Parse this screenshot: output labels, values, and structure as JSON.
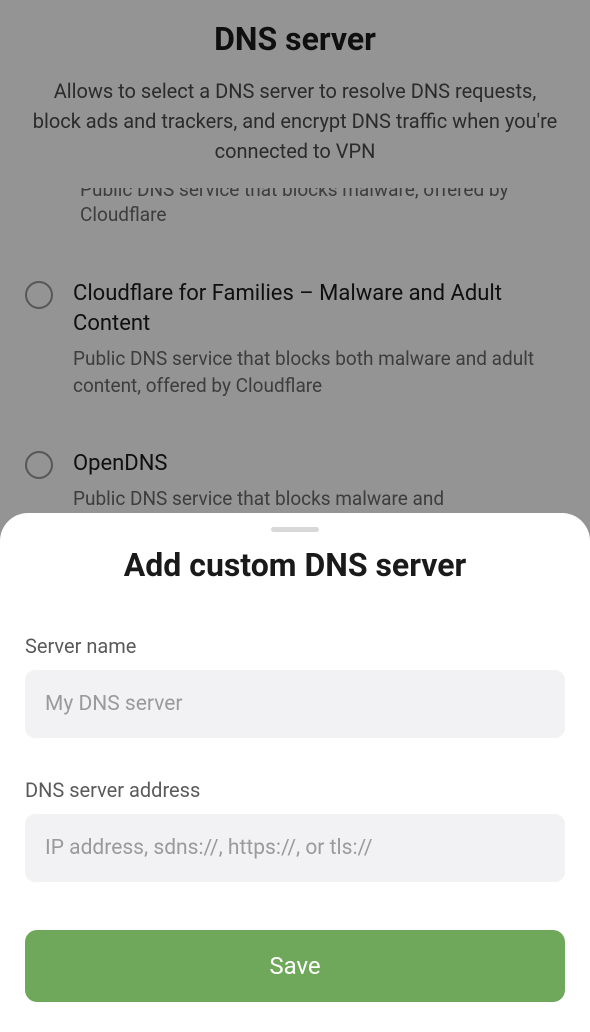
{
  "page": {
    "title": "DNS server",
    "description": "Allows to select a DNS server to resolve DNS requests, block ads and trackers, and encrypt DNS traffic when you're connected to VPN"
  },
  "dnsOptions": {
    "partialTop": {
      "descLine1": "Public DNS service that blocks malware, offered by",
      "descLine2": "Cloudflare"
    },
    "cloudflareFamilies": {
      "title": "Cloudflare for Families – Malware and Adult Content",
      "desc": "Public DNS service that blocks both malware and adult content, offered by Cloudflare"
    },
    "openDNS": {
      "title": "OpenDNS",
      "desc": "Public DNS service that blocks malware and"
    }
  },
  "modal": {
    "title": "Add custom DNS server",
    "serverName": {
      "label": "Server name",
      "placeholder": "My DNS server"
    },
    "serverAddress": {
      "label": "DNS server address",
      "placeholder": "IP address, sdns://, https://, or tls://"
    },
    "saveButton": "Save"
  }
}
